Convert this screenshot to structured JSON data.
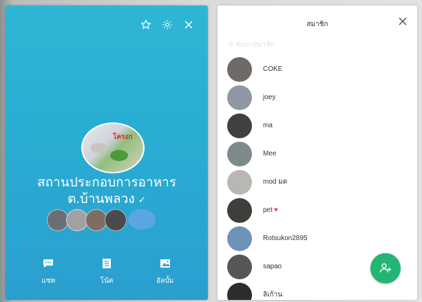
{
  "group": {
    "name_line1": "สถานประกอบการอาหาร",
    "name_line2": "ต.บ้านพลวง",
    "photo_sign": "โครงก",
    "actions": [
      {
        "label": "แชท",
        "icon": "chat-icon"
      },
      {
        "label": "โน้ต",
        "icon": "note-icon"
      },
      {
        "label": "อัลบั้ม",
        "icon": "album-icon"
      }
    ],
    "header_icons": [
      "star-icon",
      "settings-icon",
      "close-icon"
    ],
    "avatar_colors": [
      "#6b6f75",
      "#9fa1a3",
      "#7c6e62",
      "#4b4a4c"
    ],
    "more_avatar_color": "#5aa6e4",
    "panel_color": "#2cb0d4"
  },
  "members_panel": {
    "title": "สมาชิก",
    "search_placeholder": "ค้นหาสมาชิก",
    "add_button_color": "#22b573",
    "members": [
      {
        "name": "COKE",
        "color": "#6f6a66"
      },
      {
        "name": "joey",
        "color": "#8f97a4"
      },
      {
        "name": "ma",
        "color": "#3f4042"
      },
      {
        "name": "Mee",
        "color": "#7d8a8a"
      },
      {
        "name": "mod มด",
        "color": "#b9b7b2"
      },
      {
        "name": "pet",
        "color": "#3d3f3a",
        "heart": "♥"
      },
      {
        "name": "Rotsukon2895",
        "color": "#6f93b8"
      },
      {
        "name": "sapao",
        "color": "#555657"
      },
      {
        "name": "ลิเก้าน",
        "color": "#2c2b2e"
      }
    ]
  }
}
